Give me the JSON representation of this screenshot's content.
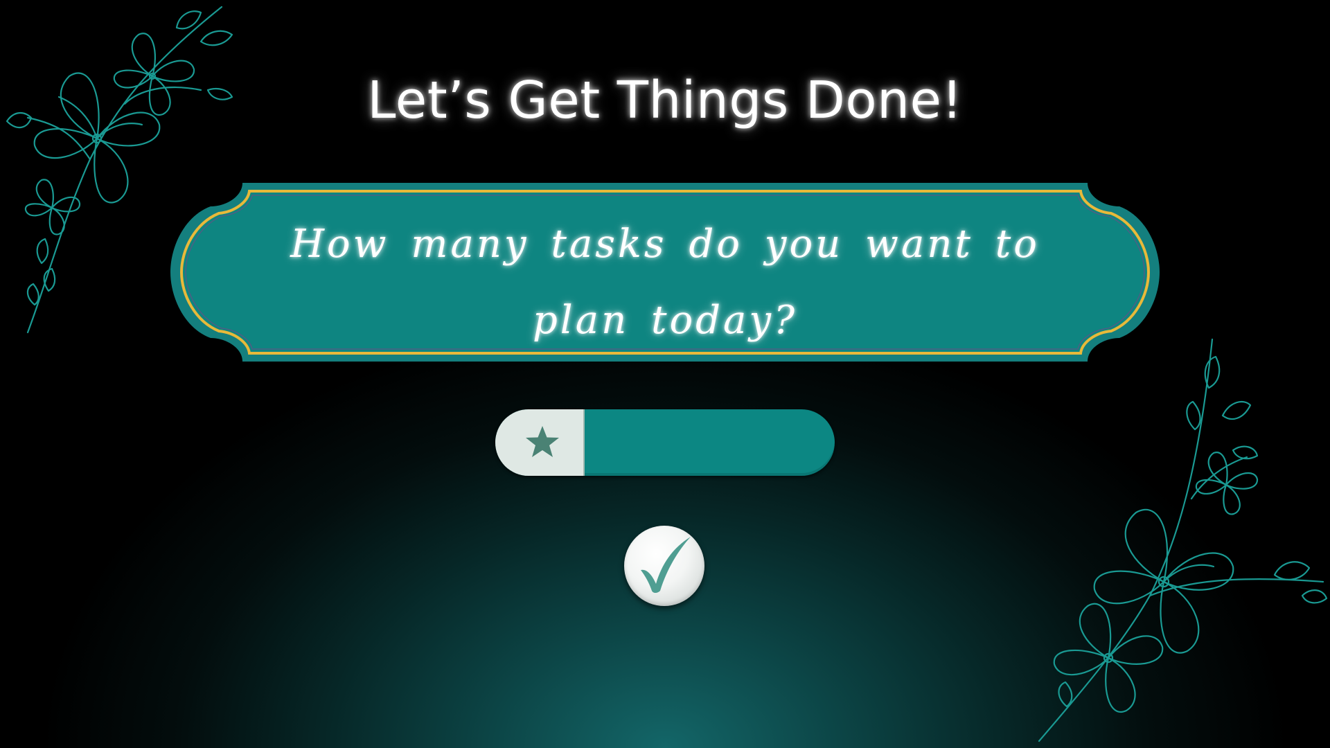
{
  "header": {
    "title": "Let’s Get Things Done!"
  },
  "prompt": {
    "question": "How many tasks do you want to plan today?"
  },
  "task_slider": {
    "value_fraction": 0.26,
    "icon": "star-icon"
  },
  "confirm": {
    "icon": "checkmark-icon"
  },
  "decorations": {
    "top_left": "floral-outline",
    "bottom_right": "floral-outline"
  },
  "colors": {
    "background_glow": "#136668",
    "banner_fill": "#0e8581",
    "banner_outer": "#147f7e",
    "banner_gold_border": "#e8b93a",
    "slider_track": "#0c8783",
    "slider_fill": "#dfe8e4",
    "star": "#4a8274",
    "check": "#4f9e92",
    "floral_line": "#1a9a93"
  }
}
